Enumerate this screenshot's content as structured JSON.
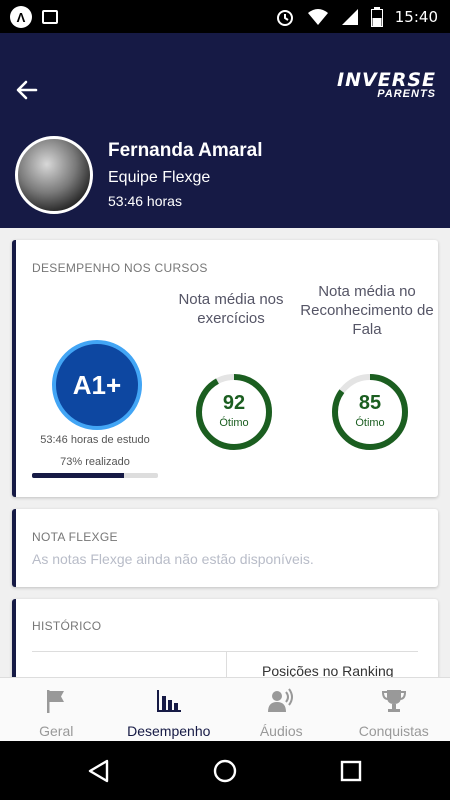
{
  "status_bar": {
    "time": "15:40"
  },
  "header": {
    "logo_main": "INVERSE",
    "logo_sub": "PARENTS",
    "name": "Fernanda Amaral",
    "team": "Equipe Flexge",
    "hours": "53:46 horas"
  },
  "performance": {
    "title": "DESEMPENHO NOS CURSOS",
    "level": "A1+",
    "study_hours": "53:46 horas de estudo",
    "realized": "73% realizado",
    "progress_fraction": 0.73,
    "exercises": {
      "label": "Nota média nos exercícios",
      "score": "92",
      "word": "Ótimo",
      "fraction": 0.92
    },
    "speech": {
      "label": "Nota média no Reconhecimento de Fala",
      "score": "85",
      "word": "Ótimo",
      "fraction": 0.85
    }
  },
  "flexge_grade": {
    "title": "NOTA FLEXGE",
    "message": "As notas Flexge ainda não estão disponíveis."
  },
  "history": {
    "title": "HISTÓRICO",
    "ranking_label": "Posições no Ranking"
  },
  "bottom_nav": {
    "items": [
      {
        "label": "Geral",
        "icon": "flag-icon"
      },
      {
        "label": "Desempenho",
        "icon": "bar-chart-icon"
      },
      {
        "label": "Áudios",
        "icon": "speaking-person-icon"
      },
      {
        "label": "Conquistas",
        "icon": "trophy-icon"
      }
    ],
    "active": "Desempenho"
  },
  "colors": {
    "header_bg": "#161a45",
    "ring_green": "#1b5e20",
    "level_blue": "#0d47a1"
  }
}
